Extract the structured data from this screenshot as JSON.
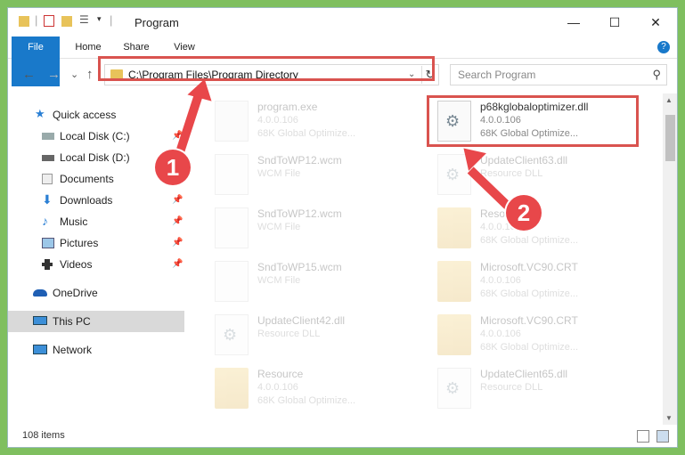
{
  "window": {
    "title": "Program",
    "minimize": "—",
    "maximize": "☐",
    "close": "✕"
  },
  "ribbon": {
    "tabs": [
      "File",
      "Home",
      "Share",
      "View"
    ],
    "help": "?"
  },
  "address": {
    "path": "C:\\Program Files\\Program Directory",
    "dropdown": "⌄",
    "refresh": "↻"
  },
  "search": {
    "placeholder": "Search Program",
    "icon": "⚲"
  },
  "nav": {
    "back": "←",
    "forward": "→",
    "recent": "⌄",
    "up": "↑"
  },
  "sidebar": {
    "items": [
      {
        "label": "Quick access",
        "icon": "star-icon",
        "pinned": false
      },
      {
        "label": "Local Disk (C:)",
        "icon": "drive-icon",
        "pinned": true
      },
      {
        "label": "Local Disk (D:)",
        "icon": "drive-icon",
        "pinned": true
      },
      {
        "label": "Documents",
        "icon": "documents-icon",
        "pinned": true
      },
      {
        "label": "Downloads",
        "icon": "download-icon",
        "pinned": true
      },
      {
        "label": "Music",
        "icon": "music-icon",
        "pinned": true
      },
      {
        "label": "Pictures",
        "icon": "pictures-icon",
        "pinned": true
      },
      {
        "label": "Videos",
        "icon": "videos-icon",
        "pinned": true
      },
      {
        "label": "OneDrive",
        "icon": "cloud-icon",
        "pinned": false
      },
      {
        "label": "This PC",
        "icon": "pc-icon",
        "pinned": false
      },
      {
        "label": "Network",
        "icon": "network-icon",
        "pinned": false
      }
    ],
    "pin_glyph": "📌"
  },
  "files": [
    {
      "name": "program.exe",
      "line2": "4.0.0.106",
      "line3": "68K Global Optimize...",
      "icon": "exe-icon"
    },
    {
      "name": "p68kglobaloptimizer.dll",
      "line2": "4.0.0.106",
      "line3": "68K Global Optimize...",
      "icon": "dll-icon"
    },
    {
      "name": "SndToWP12.wcm",
      "line2": "WCM File",
      "line3": "",
      "icon": "doc-icon"
    },
    {
      "name": "UpdateClient63.dll",
      "line2": "Resource DLL",
      "line3": "",
      "icon": "dll-icon"
    },
    {
      "name": "SndToWP12.wcm",
      "line2": "WCM File",
      "line3": "",
      "icon": "doc-icon"
    },
    {
      "name": "Resource",
      "line2": "4.0.0.106",
      "line3": "68K Global Optimize...",
      "icon": "folder-icon"
    },
    {
      "name": "SndToWP15.wcm",
      "line2": "WCM File",
      "line3": "",
      "icon": "doc-icon"
    },
    {
      "name": "Microsoft.VC90.CRT",
      "line2": "4.0.0.106",
      "line3": "68K Global Optimize...",
      "icon": "folder-icon"
    },
    {
      "name": "UpdateClient42.dll",
      "line2": "Resource DLL",
      "line3": "",
      "icon": "dll-icon"
    },
    {
      "name": "Microsoft.VC90.CRT",
      "line2": "4.0.0.106",
      "line3": "68K Global Optimize...",
      "icon": "folder-icon"
    },
    {
      "name": "Resource",
      "line2": "4.0.0.106",
      "line3": "68K Global Optimize...",
      "icon": "folder-icon"
    },
    {
      "name": "UpdateClient65.dll",
      "line2": "Resource DLL",
      "line3": "",
      "icon": "dll-icon"
    }
  ],
  "status": {
    "items": "108 items"
  },
  "annotations": {
    "badge1": "1",
    "badge2": "2",
    "color": "#e8474a"
  }
}
